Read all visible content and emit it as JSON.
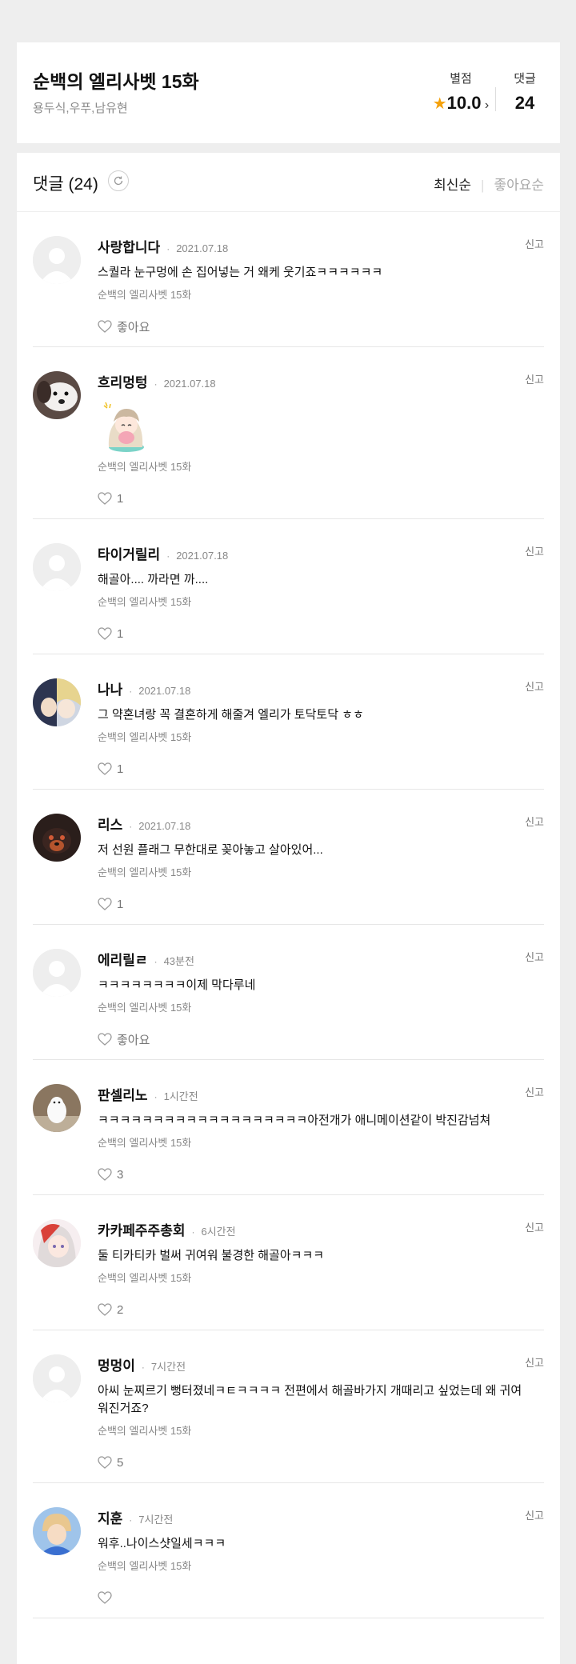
{
  "header": {
    "title": "순백의 엘리사벳 15화",
    "authors": "용두식,우푸,남유현",
    "rating_label": "별점",
    "rating_value": "10.0",
    "comments_label": "댓글",
    "comments_value": "24"
  },
  "comments_section": {
    "title": "댓글 (24)",
    "sort_latest": "최신순",
    "sort_likes": "좋아요순"
  },
  "colors": {
    "star": "#f5a10b",
    "background": "#eeeeee"
  },
  "comments": [
    {
      "nick": "사랑합니다",
      "date": "2021.07.18",
      "text": "스퀄라 눈구멍에 손 집어넣는 거 왜케 웃기죠ㅋㅋㅋㅋㅋㅋ",
      "episode": "순백의 엘리사벳 15화",
      "likes": "좋아요",
      "report": "신고"
    },
    {
      "nick": "흐리멍텅",
      "date": "2021.07.18",
      "text": "",
      "episode": "순백의 엘리사벳 15화",
      "likes": "1",
      "report": "신고"
    },
    {
      "nick": "타이거릴리",
      "date": "2021.07.18",
      "text": "해골아.... 까라면 까....",
      "episode": "순백의 엘리사벳 15화",
      "likes": "1",
      "report": "신고"
    },
    {
      "nick": "나나",
      "date": "2021.07.18",
      "text": "그 약혼녀랑 꼭 결혼하게 해줄겨 엘리가 토닥토닥 ㅎㅎ",
      "episode": "순백의 엘리사벳 15화",
      "likes": "1",
      "report": "신고"
    },
    {
      "nick": "리스",
      "date": "2021.07.18",
      "text": "저 선원 플래그 무한대로 꽂아놓고 살아있어...",
      "episode": "순백의 엘리사벳 15화",
      "likes": "1",
      "report": "신고"
    },
    {
      "nick": "에리릴ㄹ",
      "date": "43분전",
      "text": "ㅋㅋㅋㅋㅋㅋㅋㅋ이제 막다루네",
      "episode": "순백의 엘리사벳 15화",
      "likes": "좋아요",
      "report": "신고"
    },
    {
      "nick": "판셀리노",
      "date": "1시간전",
      "text": "ㅋㅋㅋㅋㅋㅋㅋㅋㅋㅋㅋㅋㅋㅋㅋㅋㅋㅋㅋ아전개가 애니메이션같이 박진감넘쳐",
      "episode": "순백의 엘리사벳 15화",
      "likes": "3",
      "report": "신고"
    },
    {
      "nick": "카카페주주총회",
      "date": "6시간전",
      "text": "둘 티카티카 벌써 귀여워 불경한 해골아ㅋㅋㅋ",
      "episode": "순백의 엘리사벳 15화",
      "likes": "2",
      "report": "신고"
    },
    {
      "nick": "멍멍이",
      "date": "7시간전",
      "text": "아씨 눈찌르기 뻥터졌네ㅋㅌㅋㅋㅋㅋ 전편에서 해골바가지 개때리고 싶었는데 왜 귀여워진거죠?",
      "episode": "순백의 엘리사벳 15화",
      "likes": "5",
      "report": "신고"
    },
    {
      "nick": "지훈",
      "date": "7시간전",
      "text": "워후..나이스샷일세ㅋㅋㅋ",
      "episode": "순백의 엘리사벳 15화",
      "likes": "",
      "report": "신고"
    }
  ]
}
